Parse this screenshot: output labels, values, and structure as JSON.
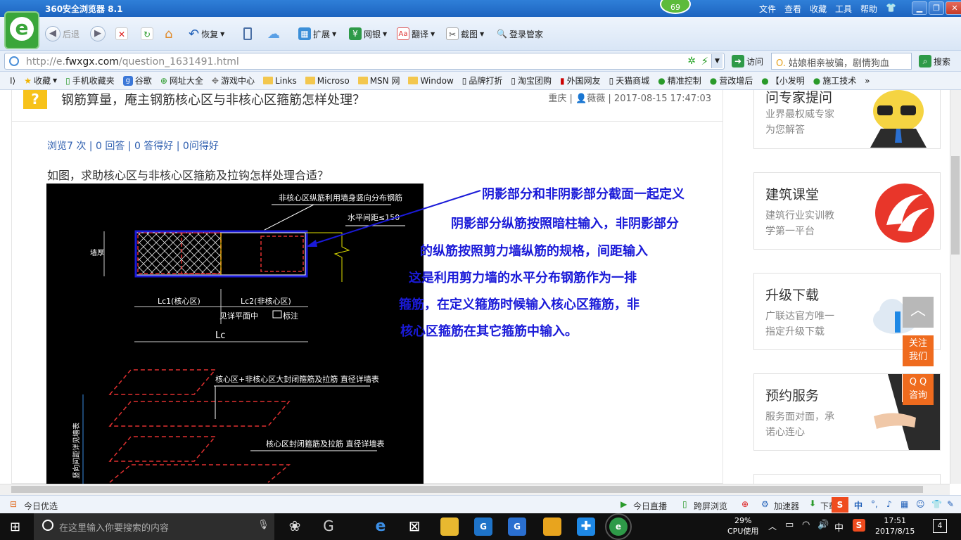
{
  "browser": {
    "title": "360安全浏览器 8.1",
    "menu": [
      "文件",
      "查看",
      "收藏",
      "工具",
      "帮助"
    ],
    "badge_count": "69",
    "toolbar": {
      "back": "后退",
      "restore": "恢复",
      "extensions": "扩展",
      "netbank": "网银",
      "translate": "翻译",
      "screenshot": "截图",
      "login_manager": "登录管家"
    },
    "url_prefix": "http://e.",
    "url_domain": "fwxgx.com",
    "url_path": "/question_1631491.html",
    "go_label": "访问",
    "search_placeholder": "姑娘相亲被骗，剧情狗血",
    "search_label": "搜索"
  },
  "bookmarks": [
    "收藏",
    "手机收藏夹",
    "谷歌",
    "网址大全",
    "游戏中心",
    "Links",
    "Microso",
    "MSN 网",
    "Window",
    "品牌打折",
    "淘宝团购",
    "外国网友",
    "天猫商城",
    "精准控制",
    "营改增后",
    "【小发明",
    "施工技术"
  ],
  "question": {
    "title": "钢筋算量，庵主钢筋核心区与非核心区箍筋怎样处理？",
    "meta_location": "重庆",
    "meta_user": "薇薇",
    "meta_time": "2017-08-15 17:47:03",
    "stats": "浏览7 次 | 0 回答 | 0 答得好 | 0问得好",
    "body": "如图，求助核心区与非核心区箍筋及拉钩怎样处理合适？"
  },
  "cad": {
    "label_nonCore": "非核心区纵筋利用墙身竖向分布钢筋",
    "label_spacing": "水平间距≤150",
    "label_left": "墙厚",
    "label_lc1": "Lc1(核心区)",
    "label_lc2": "Lc2(非核心区)",
    "label_see": "见详平面中",
    "label_see2": "标注",
    "label_lc": "Lc",
    "label_stirrup1": "核心区+非核心区大封闭箍筋及拉筋 直径详墙表",
    "label_stirrup2": "核心区封闭箍筋及拉筋 直径详墙表",
    "label_vertical": "竖向间距详见墙表"
  },
  "annotation": [
    "阴影部分和非阴影部分截面一起定义",
    "阴影部分纵筋按照暗柱输入，非阴影部分",
    "的纵筋按照剪力墙纵筋的规格，间距输入",
    "这是利用剪力墙的水平分布钢筋作为一排",
    "箍筋，在定义箍筋时候输入核心区箍筋，非",
    "核心区箍筋在其它箍筋中输入。"
  ],
  "sidebar": {
    "expert_title": "问专家提问",
    "expert_desc1": "业界最权威专家",
    "expert_desc2": "为您解答",
    "class_title": "建筑课堂",
    "class_desc1": "建筑行业实训教",
    "class_desc2": "学第一平台",
    "upgrade_title": "升级下载",
    "upgrade_desc1": "广联达官方唯一",
    "upgrade_desc2": "指定升级下载",
    "service_title": "预约服务",
    "service_desc1": "服务面对面，承",
    "service_desc2": "诺心连心"
  },
  "floating": {
    "follow": "关注\n我们",
    "follow1": "关注",
    "follow2": "我们",
    "qq1": "Q Q",
    "qq2": "咨询"
  },
  "statusbar": {
    "today": "今日优选",
    "live": "今日直播",
    "cross": "跨屏浏览",
    "accel": "加速器",
    "download": "下载"
  },
  "taskbar": {
    "search": "在这里输入你要搜索的内容",
    "cpu_pct": "29%",
    "cpu_label": "CPU使用",
    "ime": "中",
    "time": "17:51",
    "date": "2017/8/15",
    "notif": "4"
  },
  "colors": {
    "annotation": "#1a1ad8",
    "accent_orange": "#ef6b1e",
    "question_icon": "#f7c21a",
    "link_blue": "#3060b0"
  }
}
